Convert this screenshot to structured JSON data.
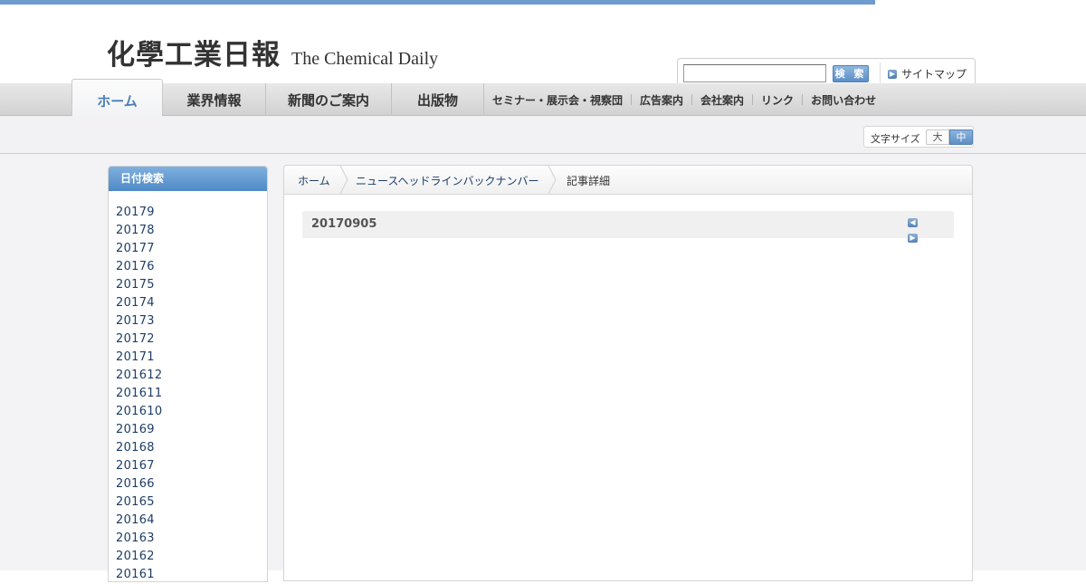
{
  "header": {
    "logo_jp": "化學工業日報",
    "logo_en": "The Chemical Daily",
    "search": {
      "value": "",
      "button_label": "検 索"
    },
    "sitemap_label": "サイトマップ"
  },
  "nav": {
    "tabs": [
      {
        "label": "ホーム",
        "active": true
      },
      {
        "label": "業界情報"
      },
      {
        "label": "新聞のご案内"
      },
      {
        "label": "出版物"
      }
    ],
    "subnav": [
      "セミナー・展示会・視察団",
      "広告案内",
      "会社案内",
      "リンク",
      "お問い合わせ"
    ]
  },
  "font_size": {
    "label": "文字サイズ",
    "large": "大",
    "medium": "中",
    "selected": "中"
  },
  "sidebar": {
    "title": "日付検索",
    "dates": [
      "20179",
      "20178",
      "20177",
      "20176",
      "20175",
      "20174",
      "20173",
      "20172",
      "20171",
      "201612",
      "201611",
      "201610",
      "20169",
      "20168",
      "20167",
      "20166",
      "20165",
      "20164",
      "20163",
      "20162",
      "20161"
    ]
  },
  "breadcrumb": [
    "ホーム",
    "ニュースヘッドラインバックナンバー",
    "記事詳細"
  ],
  "article": {
    "date": "20170905"
  },
  "colors": {
    "accent": "#5b8fc6",
    "link": "#1d3e67",
    "topbar": "#6e9bd0"
  }
}
